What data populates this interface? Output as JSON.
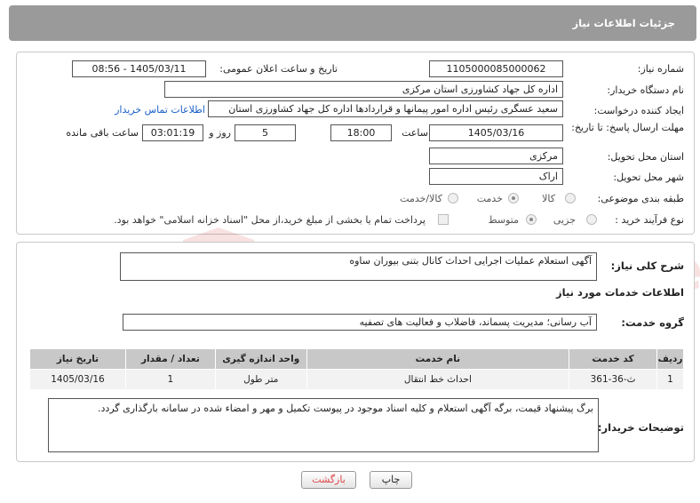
{
  "header": {
    "title": "جزئیات اطلاعات نیاز"
  },
  "form": {
    "need_number": {
      "label": "شماره نیاز:",
      "value": "1105000085000062"
    },
    "announce_datetime": {
      "label": "تاریخ و ساعت اعلان عمومی:",
      "value": "1405/03/11 - 08:56"
    },
    "buyer_org": {
      "label": "نام دستگاه خریدار:",
      "value": "اداره کل جهاد کشاورزی استان مرکزی"
    },
    "requester": {
      "label": "ایجاد کننده درخواست:",
      "value": "سعید عسگری رئیس اداره امور پیمانها و قراردادها اداره کل جهاد کشاورزی استان",
      "contact_link": "اطلاعات تماس خریدار"
    },
    "deadline": {
      "label": "مهلت ارسال پاسخ: تا تاریخ:",
      "date": "1405/03/16",
      "time_label": "ساعت",
      "time": "18:00",
      "days": "5",
      "days_label": "روز و",
      "remaining": "03:01:19",
      "remaining_label": "ساعت باقی مانده"
    },
    "province": {
      "label": "استان محل تحویل:",
      "value": "مرکزی"
    },
    "city": {
      "label": "شهر محل تحویل:",
      "value": "اراک"
    },
    "category": {
      "label": "طبقه بندی موضوعی:",
      "options": [
        "کالا",
        "خدمت",
        "کالا/خدمت"
      ],
      "selected": "خدمت"
    },
    "purchase_type": {
      "label": "نوع فرآیند خرید :",
      "options": [
        "جزیی",
        "متوسط"
      ],
      "selected": "متوسط",
      "note": "پرداخت تمام یا بخشی از مبلغ خرید،از محل \"اسناد خزانه اسلامی\" خواهد بود."
    }
  },
  "summary": {
    "label": "شرح کلی نیاز:",
    "value": "آگهی  استعلام عملیات اجرایی احداث کانال بتنی بیوران ساوه"
  },
  "services": {
    "title": "اطلاعات خدمات مورد نیاز",
    "group_label": "گروه خدمت:",
    "group_value": "آب رسانی؛ مدیریت پسماند، فاضلاب و فعالیت های تصفیه",
    "columns": [
      "ردیف",
      "کد خدمت",
      "نام خدمت",
      "واحد اندازه گیری",
      "تعداد / مقدار",
      "تاریخ نیاز"
    ],
    "rows": [
      {
        "row": "1",
        "code": "ث-36-361",
        "name": "احداث خط انتقال",
        "unit": "متر طول",
        "qty": "1",
        "date": "1405/03/16"
      }
    ]
  },
  "buyer_notes": {
    "label": "توضیحات خریدار:",
    "value": "برگ پیشنهاد قیمت، برگه آگهی استعلام و  کلیه اسناد موجود در پیوست تکمیل و مهر و امضاء شده در سامانه بارگذاری گردد."
  },
  "buttons": {
    "print": "چاپ",
    "back": "بازگشت"
  },
  "watermark": {
    "text": "AriaTender.neT"
  },
  "colors": {
    "header_bg": "#9a9a9a",
    "link": "#1a60c8",
    "table_header": "#c8c8c8",
    "back_text": "#d44"
  }
}
